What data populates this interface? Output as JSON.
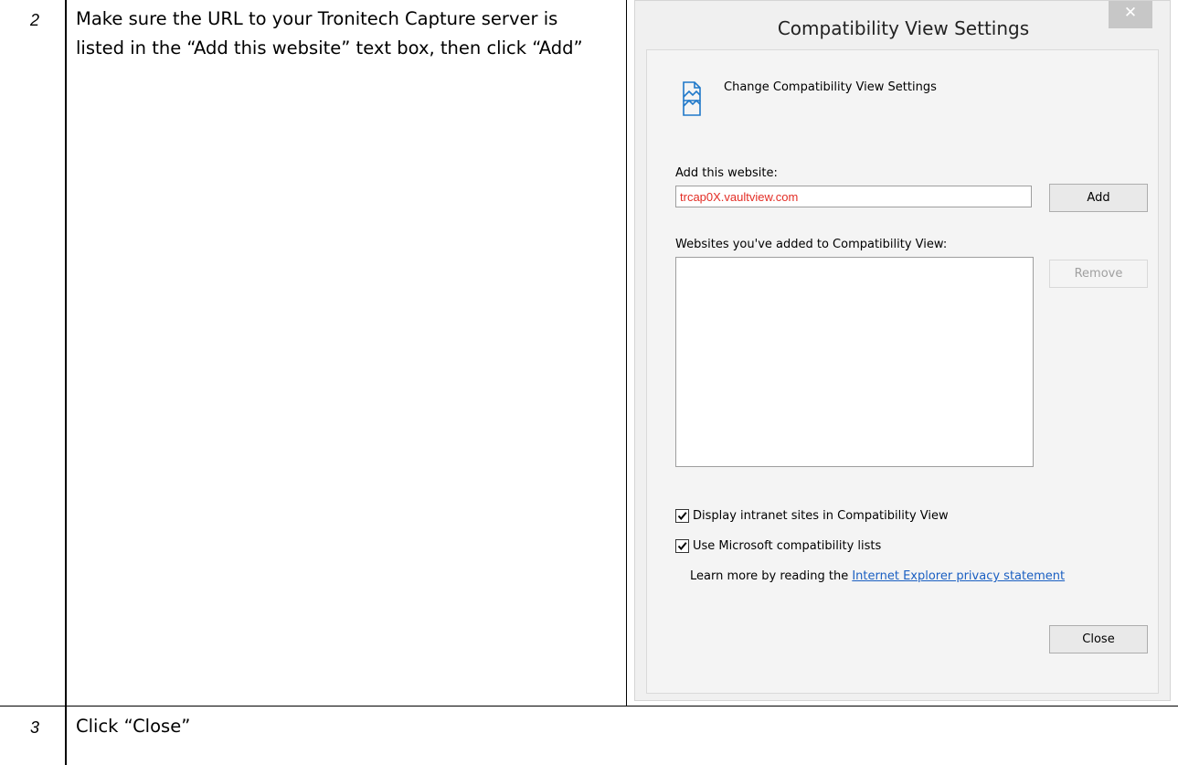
{
  "steps": [
    {
      "number": "2",
      "text": "Make sure the URL to your Tronitech Capture server is listed in the “Add this website” text box, then click “Add”"
    },
    {
      "number": "3",
      "text": "Click “Close”"
    }
  ],
  "dialog": {
    "title": "Compatibility View Settings",
    "close_glyph": "✕",
    "header_label": "Change Compatibility View Settings",
    "add_label": "Add this website:",
    "url_value": "trcap0X.vaultview.com",
    "add_button": "Add",
    "list_label": "Websites you've added to Compatibility View:",
    "remove_button": "Remove",
    "remove_enabled": false,
    "checkbox_intranet": {
      "label": "Display intranet sites in Compatibility View",
      "checked": true
    },
    "checkbox_mscompat": {
      "label": "Use Microsoft compatibility lists",
      "checked": true
    },
    "learn_more_prefix": "Learn more by reading the ",
    "learn_more_link": "Internet Explorer privacy statement",
    "close_button": "Close"
  },
  "colors": {
    "url_text": "#e32d25",
    "link": "#1a5fc2",
    "title_bar_close": "#c7c7c7"
  },
  "icons": {
    "header": "compatibility-view-page-icon",
    "check": "checkmark-icon",
    "close": "close-icon"
  }
}
